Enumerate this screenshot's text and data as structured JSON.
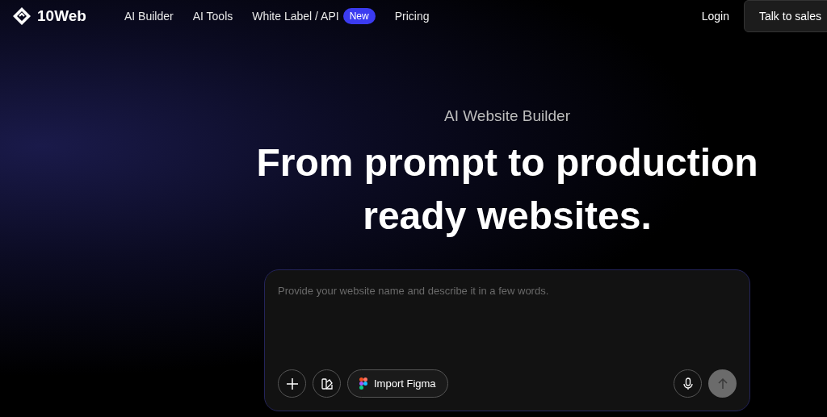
{
  "brand": {
    "name": "10Web"
  },
  "nav": [
    {
      "label": "AI Builder"
    },
    {
      "label": "AI Tools"
    },
    {
      "label": "White Label / API",
      "badge": "New"
    },
    {
      "label": "Pricing"
    }
  ],
  "login": "Login",
  "cta": "Talk to sales",
  "hero": {
    "eyebrow": "AI Website Builder",
    "headline_lines": [
      "From prompt to production",
      "ready websites."
    ]
  },
  "prompt": {
    "placeholder": "Provide your website name and describe it in a few words.",
    "import_button": "Import Figma",
    "send_disabled": true
  }
}
